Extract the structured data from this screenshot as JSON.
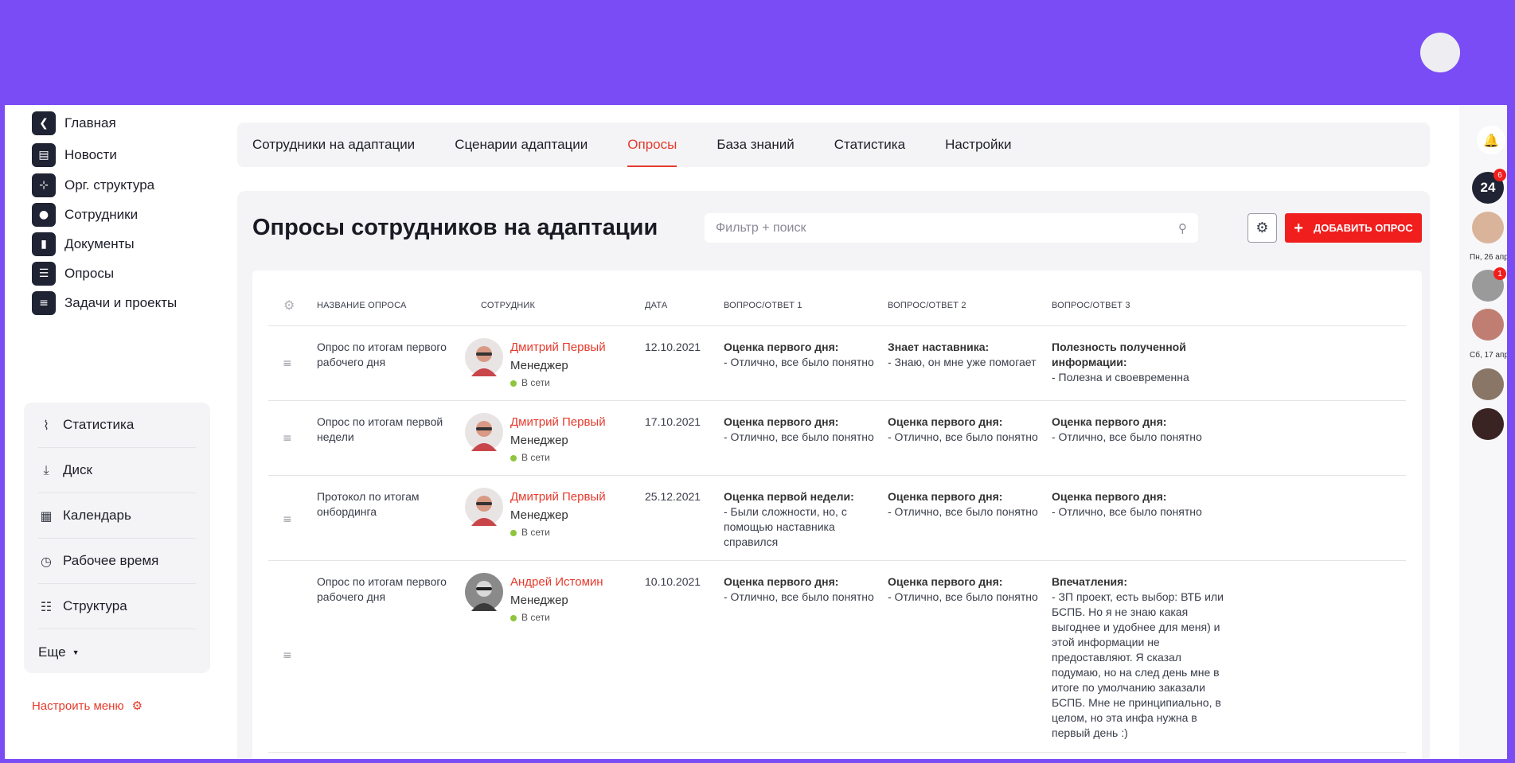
{
  "sidebar": {
    "nav": [
      {
        "label": "Главная",
        "icon": "logo-icon"
      },
      {
        "label": "Новости",
        "icon": "news-icon"
      },
      {
        "label": "Орг. структура",
        "icon": "org-structure-icon"
      },
      {
        "label": "Сотрудники",
        "icon": "employees-icon"
      },
      {
        "label": "Документы",
        "icon": "document-icon"
      },
      {
        "label": "Опросы",
        "icon": "survey-icon"
      },
      {
        "label": "Задачи и проекты",
        "icon": "tasks-icon"
      }
    ],
    "subnav": [
      {
        "label": "Статистика",
        "icon": "chart-icon"
      },
      {
        "label": "Диск",
        "icon": "disk-icon"
      },
      {
        "label": "Календарь",
        "icon": "calendar-icon"
      },
      {
        "label": "Рабочее время",
        "icon": "clock-icon"
      },
      {
        "label": "Структура",
        "icon": "structure-icon"
      },
      {
        "label": "Еще",
        "icon": "caret-down-icon"
      }
    ],
    "customize_label": "Настроить меню"
  },
  "tabs": [
    {
      "label": "Сотрудники на адаптации",
      "active": false
    },
    {
      "label": "Сценарии адаптации",
      "active": false
    },
    {
      "label": "Опросы",
      "active": true
    },
    {
      "label": "База знаний",
      "active": false
    },
    {
      "label": "Статистика",
      "active": false
    },
    {
      "label": "Настройки",
      "active": false
    }
  ],
  "page": {
    "title": "Опросы сотрудников на адаптации",
    "search_placeholder": "Фильтр + поиск",
    "add_button": "ДОБАВИТЬ ОПРОС"
  },
  "table": {
    "headers": {
      "name": "НАЗВАНИЕ ОПРОСА",
      "employee": "СОТРУДНИК",
      "date": "ДАТА",
      "q1": "ВОПРОС/ОТВЕТ 1",
      "q2": "ВОПРОС/ОТВЕТ 2",
      "q3": "ВОПРОС/ОТВЕТ 3"
    },
    "rows": [
      {
        "name": "Опрос по итогам первого рабочего дня",
        "employee": "Дмитрий Первый",
        "role": "Менеджер",
        "status": "В сети",
        "date": "12.10.2021",
        "q1_title": "Оценка первого дня:",
        "q1_answer": "- Отлично, все было понятно",
        "q2_title": "Знает наставника:",
        "q2_answer": "- Знаю, он мне уже помогает",
        "q3_title": "Полезность полученной информации:",
        "q3_answer": "- Полезна и своевременна"
      },
      {
        "name": "Опрос по итогам первой недели",
        "employee": "Дмитрий Первый",
        "role": "Менеджер",
        "status": "В сети",
        "date": "17.10.2021",
        "q1_title": "Оценка первого дня:",
        "q1_answer": "- Отлично, все было понятно",
        "q2_title": "Оценка первого дня:",
        "q2_answer": "- Отлично, все было понятно",
        "q3_title": "Оценка первого дня:",
        "q3_answer": "- Отлично, все было понятно"
      },
      {
        "name": "Протокол по итогам онбординга",
        "employee": "Дмитрий Первый",
        "role": "Менеджер",
        "status": "В сети",
        "date": "25.12.2021",
        "q1_title": "Оценка первой недели:",
        "q1_answer": "- Были сложности, но, с помощью наставника справился",
        "q2_title": "Оценка первого дня:",
        "q2_answer": "- Отлично, все было понятно",
        "q3_title": "Оценка первого дня:",
        "q3_answer": "- Отлично, все было понятно"
      },
      {
        "name": "Опрос по итогам первого рабочего дня",
        "employee": "Андрей Истомин",
        "role": "Менеджер",
        "status": "В сети",
        "date": "10.10.2021",
        "q1_title": "Оценка первого дня:",
        "q1_answer": "- Отлично, все было понятно",
        "q2_title": "Оценка первого дня:",
        "q2_answer": "- Отлично, все было понятно",
        "q3_title": "Впечатления:",
        "q3_answer": "- ЗП проект, есть выбор: ВТБ или БСПБ. Но я не знаю какая выгоднее и удобнее для меня) и этой информации не предоставляют. Я сказал подумаю, но на след день мне в итоге по умолчанию заказали БСПБ. Мне не принципиально, в целом, но эта инфа нужна в первый день :)"
      }
    ]
  },
  "rail": {
    "logo_text": "24",
    "badge_1": "6",
    "date_1": "Пн, 26 апр",
    "badge_2": "1",
    "date_2": "Сб, 17 апр"
  },
  "colors": {
    "brand_purple": "#7a4cf5",
    "accent_red": "#e63a2c",
    "button_red": "#f11e1e",
    "online_green": "#8fc43e"
  }
}
